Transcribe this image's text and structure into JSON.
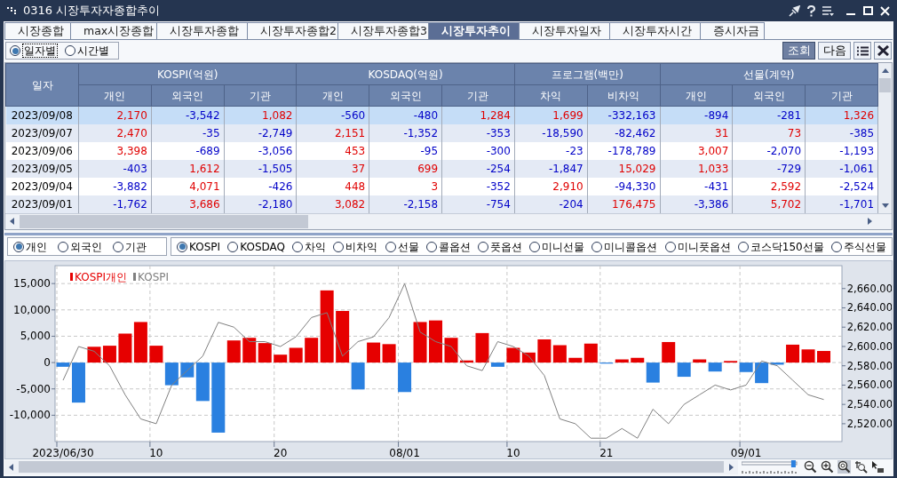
{
  "window": {
    "title": "0316 시장투자자종합추이"
  },
  "tabs": [
    {
      "label": "시장종합",
      "selected": false
    },
    {
      "label": "max시장종합",
      "selected": false
    },
    {
      "label": "시장투자종합",
      "selected": false
    },
    {
      "label": "시장투자종합2",
      "selected": false
    },
    {
      "label": "시장투자종합3",
      "selected": false
    },
    {
      "label": "시장투자추이",
      "selected": true
    },
    {
      "label": "시장투자일자",
      "selected": false
    },
    {
      "label": "시장투자시간",
      "selected": false
    },
    {
      "label": "증시자금",
      "selected": false
    }
  ],
  "period_options": [
    {
      "label": "일자별",
      "selected": true
    },
    {
      "label": "시간별",
      "selected": false
    }
  ],
  "toolbar_buttons": [
    "조회",
    "다음"
  ],
  "table": {
    "first_column": "일자",
    "groups": [
      {
        "label": "KOSPI(억원)",
        "columns": [
          "개인",
          "외국인",
          "기관"
        ]
      },
      {
        "label": "KOSDAQ(억원)",
        "columns": [
          "개인",
          "외국인",
          "기관"
        ]
      },
      {
        "label": "프로그램(백만)",
        "columns": [
          "차익",
          "비차익"
        ]
      },
      {
        "label": "선물(계약)",
        "columns": [
          "개인",
          "외국인",
          "기관"
        ]
      }
    ],
    "rows": [
      {
        "date": "2023/09/08",
        "selected": true,
        "values": [
          "2,170",
          "-3,542",
          "1,082",
          "-560",
          "-480",
          "1,284",
          "1,699",
          "-332,163",
          "-894",
          "-281",
          "1,326"
        ]
      },
      {
        "date": "2023/09/07",
        "selected": false,
        "values": [
          "2,470",
          "-35",
          "-2,749",
          "2,151",
          "-1,352",
          "-353",
          "-18,590",
          "-82,462",
          "31",
          "73",
          "-385"
        ]
      },
      {
        "date": "2023/09/06",
        "selected": false,
        "values": [
          "3,398",
          "-689",
          "-3,056",
          "453",
          "-95",
          "-300",
          "-23",
          "-178,789",
          "3,007",
          "-2,070",
          "-1,193"
        ]
      },
      {
        "date": "2023/09/05",
        "selected": false,
        "values": [
          "-403",
          "1,612",
          "-1,505",
          "37",
          "699",
          "-254",
          "-1,847",
          "15,029",
          "1,033",
          "-729",
          "-1,061"
        ]
      },
      {
        "date": "2023/09/04",
        "selected": false,
        "values": [
          "-3,882",
          "4,071",
          "-426",
          "448",
          "3",
          "-352",
          "2,910",
          "-94,330",
          "-431",
          "2,592",
          "-2,524"
        ]
      },
      {
        "date": "2023/09/01",
        "selected": false,
        "values": [
          "-1,762",
          "3,686",
          "-2,180",
          "3,082",
          "-2,158",
          "-754",
          "-204",
          "176,475",
          "-3,386",
          "5,702",
          "-1,701"
        ]
      }
    ]
  },
  "investor_options": [
    {
      "label": "개인",
      "selected": true
    },
    {
      "label": "외국인",
      "selected": false
    },
    {
      "label": "기관",
      "selected": false
    }
  ],
  "market_options": [
    {
      "label": "KOSPI",
      "selected": true
    },
    {
      "label": "KOSDAQ",
      "selected": false
    },
    {
      "label": "차익",
      "selected": false
    },
    {
      "label": "비차익",
      "selected": false
    },
    {
      "label": "선물",
      "selected": false
    },
    {
      "label": "콜옵션",
      "selected": false
    },
    {
      "label": "풋옵션",
      "selected": false
    },
    {
      "label": "미니선물",
      "selected": false
    },
    {
      "label": "미니콜옵션",
      "selected": false
    },
    {
      "label": "미니풋옵션",
      "selected": false
    },
    {
      "label": "코스닥150선물",
      "selected": false
    },
    {
      "label": "주식선물",
      "selected": false
    }
  ],
  "chart": {
    "chart_data": {
      "type": "bar",
      "categories": [
        "2023/06/30",
        null,
        null,
        null,
        null,
        null,
        "10",
        null,
        null,
        null,
        null,
        null,
        null,
        null,
        "20",
        null,
        null,
        null,
        null,
        null,
        null,
        null,
        "08/01",
        null,
        null,
        null,
        null,
        null,
        null,
        "10",
        null,
        null,
        null,
        null,
        null,
        "21",
        null,
        null,
        null,
        null,
        null,
        null,
        null,
        null,
        "09/01",
        null,
        null,
        null,
        null,
        null
      ],
      "series": [
        {
          "name": "KOSPI개인",
          "type": "bar",
          "color": "#e60000",
          "values": [
            null,
            null,
            3000,
            3200,
            5500,
            7700,
            3200,
            null,
            null,
            null,
            null,
            4200,
            4700,
            3700,
            1500,
            2800,
            4700,
            13700,
            9800,
            null,
            3800,
            3500,
            null,
            7700,
            8000,
            4700,
            400,
            5600,
            null,
            2800,
            1900,
            4400,
            3300,
            900,
            3600,
            null,
            600,
            900,
            null,
            3900,
            null,
            600,
            null,
            300,
            null,
            null,
            null,
            3400,
            2500,
            2200
          ]
        },
        {
          "type": "bar",
          "color": "#2a80e0",
          "values": [
            -800,
            -7600,
            null,
            null,
            null,
            null,
            null,
            -4300,
            -2800,
            -7300,
            -13300,
            null,
            null,
            null,
            null,
            null,
            null,
            null,
            null,
            -5100,
            null,
            null,
            -5600,
            null,
            null,
            null,
            null,
            null,
            -800,
            null,
            null,
            null,
            null,
            null,
            null,
            -200,
            null,
            null,
            -3800,
            null,
            -2700,
            null,
            -1700,
            null,
            -1800,
            -3900,
            -400,
            null,
            null,
            null
          ]
        },
        {
          "name": "KOSPI",
          "type": "line",
          "axis": "y2",
          "color": "#808080",
          "values": [
            2565,
            2600,
            2595,
            2580,
            2550,
            2525,
            2520,
            2560,
            2575,
            2590,
            2625,
            2620,
            2605,
            2605,
            2600,
            2610,
            2630,
            2635,
            2590,
            2605,
            2610,
            2630,
            2665,
            2615,
            2605,
            2600,
            2580,
            2575,
            2605,
            2600,
            2590,
            2570,
            2525,
            2520,
            2505,
            2505,
            2515,
            2505,
            2535,
            2520,
            2540,
            2550,
            2560,
            2555,
            2560,
            2585,
            2580,
            2565,
            2550,
            2545
          ]
        }
      ],
      "stacked": true,
      "grid": true,
      "legend": true,
      "ylim": [
        -15000,
        18400
      ],
      "yticks": [
        {
          "value": 15000,
          "label": "15,000"
        },
        {
          "value": 10000,
          "label": "10,000"
        },
        {
          "value": 5000,
          "label": "5,000"
        },
        {
          "value": 0,
          "label": "0"
        },
        {
          "value": -5000,
          "label": "-5,000"
        },
        {
          "value": -10000,
          "label": "-10,000"
        }
      ],
      "y2lim": [
        2501.5,
        2683.7
      ],
      "y2ticks": [
        {
          "value": 2660,
          "label": "2,660.00"
        },
        {
          "value": 2640,
          "label": "2,640.00"
        },
        {
          "value": 2620,
          "label": "2,620.00"
        },
        {
          "value": 2600,
          "label": "2,600.00"
        },
        {
          "value": 2580,
          "label": "2,580.00"
        },
        {
          "value": 2560,
          "label": "2,560.00"
        },
        {
          "value": 2540,
          "label": "2,540.00"
        },
        {
          "value": 2520,
          "label": "2,520.00"
        }
      ]
    }
  },
  "zoom_slider": {
    "level": 0.95
  }
}
